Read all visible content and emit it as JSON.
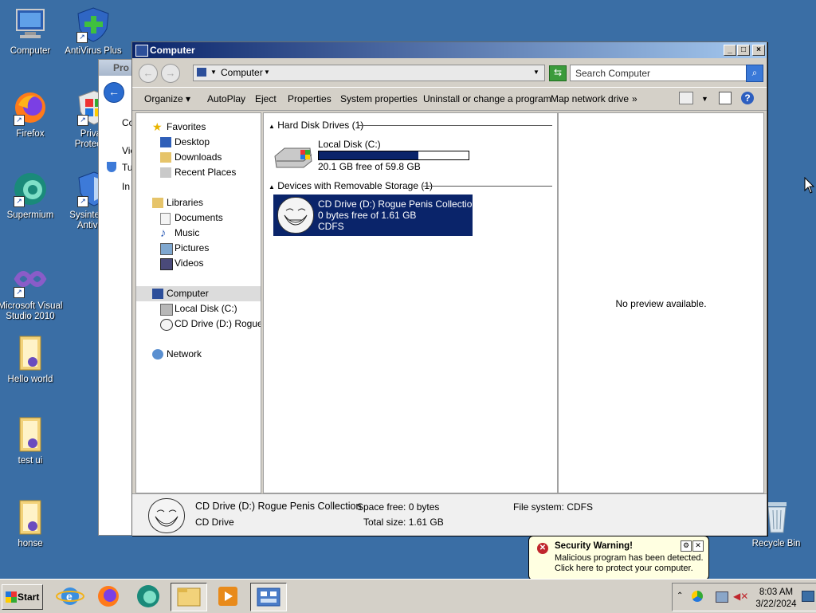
{
  "desktop": {
    "icons": [
      {
        "label": "Computer"
      },
      {
        "label": "AntiVirus Plus"
      },
      {
        "label": "Firefox"
      },
      {
        "label": "Privacy Protection",
        "visible": "Priva Protec"
      },
      {
        "label": "Supermium"
      },
      {
        "label": "Sysinternals Antivirus",
        "visible": "Sysinte Antivi"
      },
      {
        "label": "Microsoft Visual Studio 2010"
      },
      {
        "label": "Hello world"
      },
      {
        "label": "test ui"
      },
      {
        "label": "honse"
      },
      {
        "label": "Recycle Bin"
      }
    ]
  },
  "bg_window": {
    "title_fragment": "Pro",
    "fragments": [
      "Co",
      "Vie",
      "Tu",
      "In"
    ]
  },
  "window": {
    "title": "Computer",
    "address": "Computer",
    "search_placeholder": "Search Computer",
    "commands": [
      "Organize",
      "AutoPlay",
      "Eject",
      "Properties",
      "System properties",
      "Uninstall or change a program",
      "Map network drive",
      "»"
    ],
    "nav": {
      "favorites": "Favorites",
      "desktop": "Desktop",
      "downloads": "Downloads",
      "recent": "Recent Places",
      "libraries": "Libraries",
      "documents": "Documents",
      "music": "Music",
      "pictures": "Pictures",
      "videos": "Videos",
      "computer": "Computer",
      "local_disk": "Local Disk (C:)",
      "cd_drive": "CD Drive (D:) Rogue P",
      "network": "Network"
    },
    "groups": {
      "hard": "Hard Disk Drives (1)",
      "removable": "Devices with Removable Storage (1)"
    },
    "drive_c": {
      "name": "Local Disk (C:)",
      "free": "20.1 GB free of 59.8 GB",
      "used_fraction": 0.664
    },
    "drive_d": {
      "name": "CD Drive (D:) Rogue Penis Collection",
      "free": "0 bytes free of 1.61 GB",
      "fs": "CDFS"
    },
    "preview": "No preview available.",
    "details": {
      "name": "CD Drive (D:) Rogue Penis Collection",
      "type": "CD Drive",
      "space_free": "Space free: 0 bytes",
      "total_size": "Total size: 1.61 GB",
      "file_system": "File system: CDFS"
    }
  },
  "notification": {
    "title": "Security Warning!",
    "line1": "Malicious program has been detected.",
    "line2": "Click here to protect your computer."
  },
  "taskbar": {
    "start": "Start",
    "time": "8:03 AM",
    "date": "3/22/2024"
  }
}
